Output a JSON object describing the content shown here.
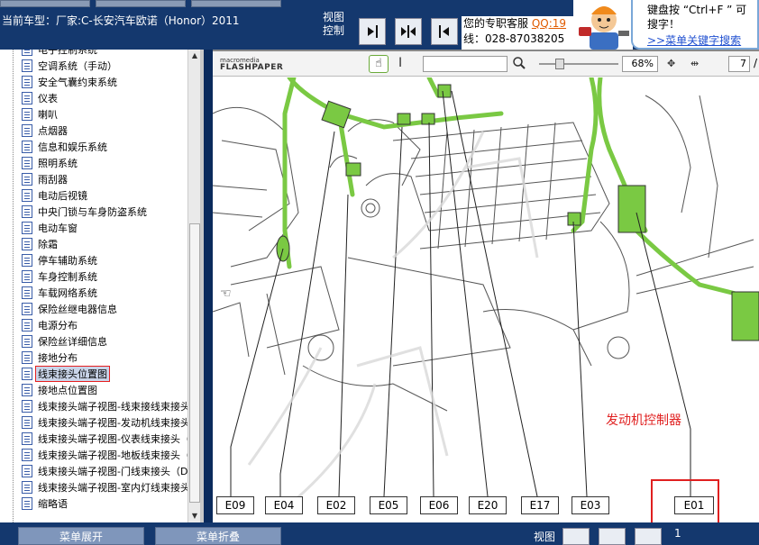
{
  "header": {
    "vehicle_label": "当前车型：厂家:C-长安汽车欧诺（Honor）2011",
    "view_label": "视图控制",
    "service_text": "您的专职客服",
    "service_qq": "QQ:19",
    "service_line2": "线：028-87038205",
    "help_text": "键盘按 “Ctrl+F ” 可搜字！",
    "help_link": ">>菜单关键字搜索"
  },
  "tree": {
    "items": [
      {
        "label": "电子控制系统"
      },
      {
        "label": "空调系统（手动）"
      },
      {
        "label": "安全气囊约束系统"
      },
      {
        "label": "仪表"
      },
      {
        "label": "喇叭"
      },
      {
        "label": "点烟器"
      },
      {
        "label": "信息和娱乐系统"
      },
      {
        "label": "照明系统"
      },
      {
        "label": "雨刮器"
      },
      {
        "label": "电动后视镜"
      },
      {
        "label": "中央门锁与车身防盗系统"
      },
      {
        "label": "电动车窗"
      },
      {
        "label": "除霜"
      },
      {
        "label": "停车辅助系统"
      },
      {
        "label": "车身控制系统"
      },
      {
        "label": "车载网络系统"
      },
      {
        "label": "保险丝继电器信息"
      },
      {
        "label": "电源分布"
      },
      {
        "label": "保险丝详细信息"
      },
      {
        "label": "接地分布"
      },
      {
        "label": "线束接头位置图"
      },
      {
        "label": "接地点位置图"
      },
      {
        "label": "线束接头端子视图-线束接线束接头"
      },
      {
        "label": "线束接头端子视图-发动机线束接头"
      },
      {
        "label": "线束接头端子视图-仪表线束接头（"
      },
      {
        "label": "线束接头端子视图-地板线束接头（"
      },
      {
        "label": "线束接头端子视图-门线束接头（D"
      },
      {
        "label": "线束接头端子视图-室内灯线束接头"
      },
      {
        "label": "缩略语"
      }
    ],
    "selected_index": 20
  },
  "viewer": {
    "logo_top": "macromedia",
    "logo_bottom": "FLASHPAPER",
    "search_value": "",
    "zoom_value": "68%",
    "page_value": "7",
    "page_sep": "/"
  },
  "diagram": {
    "codes": [
      "E09",
      "E04",
      "E02",
      "E05",
      "E06",
      "E20",
      "E17",
      "E03",
      "E01"
    ],
    "ecu_label": "发动机控制器",
    "harness_color": "#7ac943"
  },
  "bottom": {
    "expand_label": "菜单展开",
    "collapse_label": "菜单折叠",
    "view_label": "视图",
    "page_num": "1"
  }
}
